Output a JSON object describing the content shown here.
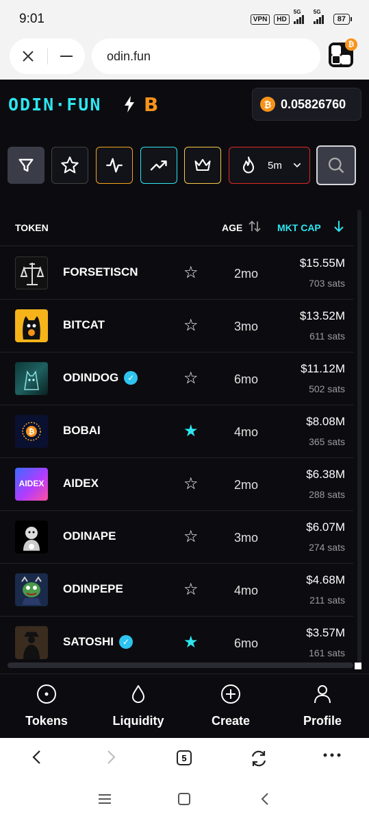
{
  "status_bar": {
    "time": "9:01",
    "vpn": "VPN",
    "hd": "HD",
    "net1": "5G",
    "net2": "5G",
    "battery": "87"
  },
  "browser": {
    "url": "odin.fun",
    "close_icon": "close-icon",
    "minimize_icon": "minimize-icon",
    "extension_badge": "₿",
    "tab_count": "5"
  },
  "header": {
    "logo": "ODIN·FUN",
    "logo_mark": "B",
    "btc_symbol": "₿",
    "balance": "0.05826760"
  },
  "filters": {
    "timeframe": "5m"
  },
  "table": {
    "headers": {
      "token": "TOKEN",
      "age": "AGE",
      "mktcap": "MKT CAP"
    },
    "rows": [
      {
        "name": "FORSETISCN",
        "verified": false,
        "favorite": false,
        "age": "2mo",
        "mcap": "$15.55M",
        "sats": "703 sats"
      },
      {
        "name": "BITCAT",
        "verified": false,
        "favorite": false,
        "age": "3mo",
        "mcap": "$13.52M",
        "sats": "611 sats"
      },
      {
        "name": "ODINDOG",
        "verified": true,
        "favorite": false,
        "age": "6mo",
        "mcap": "$11.12M",
        "sats": "502 sats"
      },
      {
        "name": "BOBAI",
        "verified": false,
        "favorite": true,
        "age": "4mo",
        "mcap": "$8.08M",
        "sats": "365 sats"
      },
      {
        "name": "AIDEX",
        "verified": false,
        "favorite": false,
        "age": "2mo",
        "mcap": "$6.38M",
        "sats": "288 sats"
      },
      {
        "name": "ODINAPE",
        "verified": false,
        "favorite": false,
        "age": "3mo",
        "mcap": "$6.07M",
        "sats": "274 sats"
      },
      {
        "name": "ODINPEPE",
        "verified": false,
        "favorite": false,
        "age": "4mo",
        "mcap": "$4.68M",
        "sats": "211 sats"
      },
      {
        "name": "SATOSHI",
        "verified": true,
        "favorite": true,
        "age": "6mo",
        "mcap": "$3.57M",
        "sats": "161 sats"
      }
    ],
    "avatar_logos": {
      "aidex": "AIDEX"
    }
  },
  "bottom_nav": {
    "tokens": "Tokens",
    "liquidity": "Liquidity",
    "create": "Create",
    "profile": "Profile"
  },
  "colors": {
    "accent": "#2ee6f0",
    "bitcoin": "#f7931a",
    "background": "#0c0c10"
  }
}
